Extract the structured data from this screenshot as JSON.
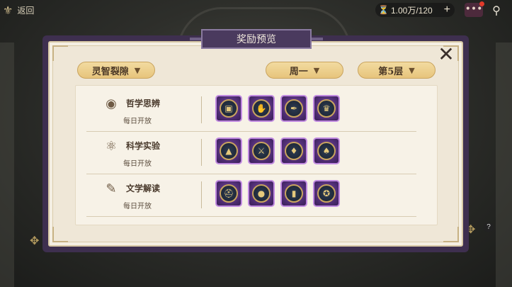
{
  "topbar": {
    "back_label": "返回",
    "resource_value": "1.00万/120",
    "plus_icon": "plus-icon",
    "chat_icon": "chat-icon",
    "map_icon": "map-pin-icon"
  },
  "dialog": {
    "title": "奖励预览",
    "filters": {
      "realm": "灵智裂隙",
      "day": "周一",
      "floor": "第5层"
    },
    "categories": [
      {
        "name": "哲学思辨",
        "schedule": "每日开放",
        "icon": "eye-icon",
        "rewards": [
          "bag-icon",
          "hand-icon",
          "feather-quill-icon",
          "trophy-icon"
        ]
      },
      {
        "name": "科学实验",
        "schedule": "每日开放",
        "icon": "atom-icon",
        "rewards": [
          "pyramid-eye-icon",
          "wand-icon",
          "torch-icon",
          "crystal-icon"
        ]
      },
      {
        "name": "文学解读",
        "schedule": "每日开放",
        "icon": "quill-icon",
        "rewards": [
          "hat-icon",
          "orb-icon",
          "book-icon",
          "shield-icon"
        ]
      }
    ]
  },
  "colors": {
    "dialog_bg": "#efe7d7",
    "title_plate": "#4a3a5e",
    "dropdown_gold": "#e7c47c",
    "reward_frame": "#c08ae0"
  }
}
